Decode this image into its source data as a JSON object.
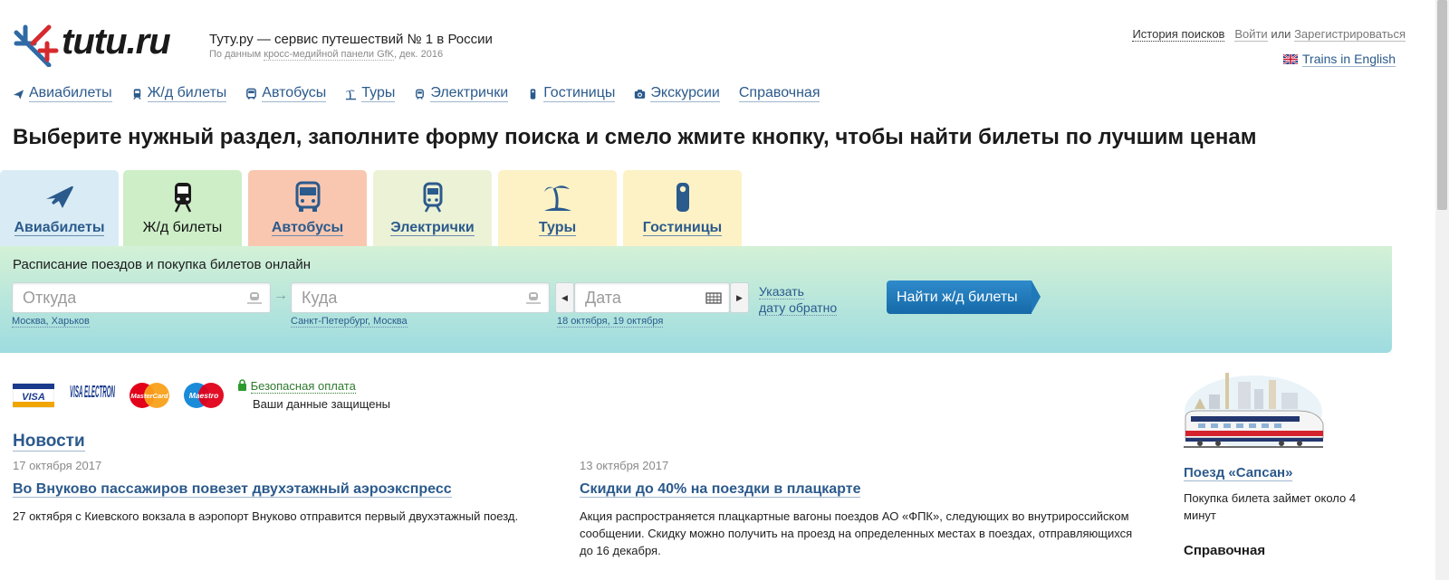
{
  "header": {
    "logo_text": "tutu.ru",
    "tagline": "Туту.ру — сервис путешествий № 1 в России",
    "tagline_sub_prefix": "По данным ",
    "tagline_sub_link": "кросс-медийной панели GfK",
    "tagline_sub_suffix": ", дек. 2016",
    "history": "История поисков",
    "login": "Войти",
    "or": "или",
    "register": "Зарегистрироваться",
    "trains_english": "Trains in English"
  },
  "topnav": [
    {
      "label": "Авиабилеты",
      "icon": "plane-icon"
    },
    {
      "label": "Ж/д билеты",
      "icon": "train-icon"
    },
    {
      "label": "Автобусы",
      "icon": "bus-icon"
    },
    {
      "label": "Туры",
      "icon": "palm-icon"
    },
    {
      "label": "Электрички",
      "icon": "suburban-train-icon"
    },
    {
      "label": "Гостиницы",
      "icon": "door-hanger-icon"
    },
    {
      "label": "Экскурсии",
      "icon": "camera-icon"
    },
    {
      "label": "Справочная",
      "icon": ""
    }
  ],
  "headline": "Выберите нужный раздел, заполните форму поиска и смело жмите кнопку, чтобы найти билеты по лучшим ценам",
  "tabs": [
    {
      "label": "Авиабилеты",
      "color": "#d9ecf5",
      "active": false
    },
    {
      "label": "Ж/д билеты",
      "color": "#cdeec7",
      "active": true
    },
    {
      "label": "Автобусы",
      "color": "#f9c7b0",
      "active": false
    },
    {
      "label": "Электрички",
      "color": "#ecf2d6",
      "active": false
    },
    {
      "label": "Туры",
      "color": "#fdf2c6",
      "active": false
    },
    {
      "label": "Гостиницы",
      "color": "#fdf2c6",
      "active": false
    }
  ],
  "search": {
    "title": "Расписание поездов и покупка билетов онлайн",
    "from_placeholder": "Откуда",
    "from_hint": "Москва, Харьков",
    "to_placeholder": "Куда",
    "to_hint": "Санкт-Петербург, Москва",
    "date_placeholder": "Дата",
    "date_hint": "18 октября, 19 октября",
    "return_line1": "Указать",
    "return_line2": "дату обратно",
    "submit": "Найти ж/д билеты",
    "arrow": "→",
    "prev": "◀",
    "next": "▶"
  },
  "payment": {
    "cards": [
      "VISA",
      "VISA ELECTRON",
      "MasterCard",
      "Maestro"
    ],
    "secure": "Безопасная оплата",
    "secure_sub": "Ваши данные защищены"
  },
  "news": {
    "heading": "Новости",
    "items": [
      {
        "date": "17 октября 2017",
        "title": "Во Внуково пассажиров повезет двухэтажный аэроэкспресс",
        "body": "27 октября с Киевского вокзала в аэропорт Внуково отправится первый двухэтажный поезд."
      },
      {
        "date": "13 октября 2017",
        "title": "Скидки до 40% на поездки в плацкарте",
        "body": "Акция распространяется плацкартные вагоны поездов АО «ФПК», следующих во внутрироссийском сообщении. Скидку можно получить на проезд на определенных местах в поездах, отправляющихся до 16 декабря."
      }
    ]
  },
  "sidebar": {
    "sapsan_title": "Поезд «Сапсан»",
    "sapsan_desc": "Покупка билета займет около 4 минут",
    "sprav": "Справочная"
  },
  "colors": {
    "link": "#2b5a8c",
    "button": "#1f78b8",
    "logo_red": "#d72a2e",
    "logo_blue": "#2f6aa7"
  }
}
